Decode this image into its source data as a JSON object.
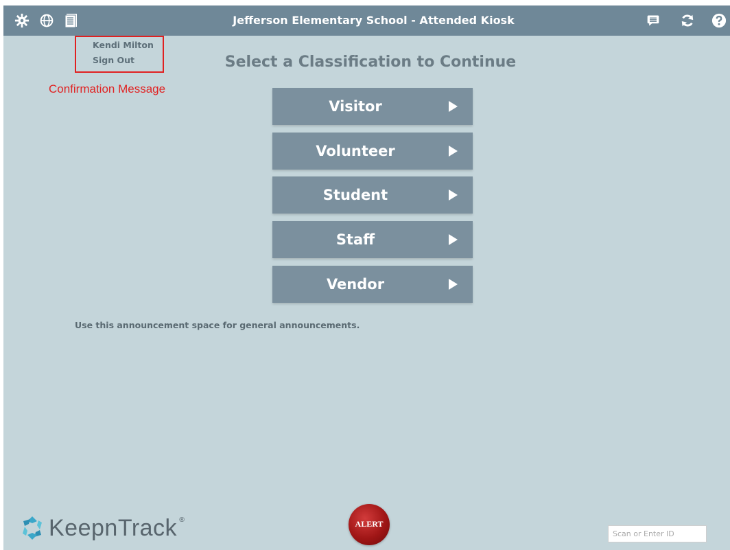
{
  "header": {
    "title": "Jefferson Elementary School - Attended Kiosk",
    "left_icons": [
      "settings-gear-icon",
      "globe-icon",
      "document-icon"
    ],
    "right_icons": [
      "message-icon",
      "refresh-icon",
      "help-icon"
    ]
  },
  "user": {
    "name": "Kendi Milton",
    "sign_out": "Sign Out"
  },
  "confirmation": {
    "text": "Confirmation Message"
  },
  "page_title": "Select a Classification to Continue",
  "classifications": [
    "Visitor",
    "Volunteer",
    "Student",
    "Staff",
    "Vendor"
  ],
  "announcement": "Use this announcement space for general announcements.",
  "footer": {
    "brand": "KeepnTrack",
    "registered": "®",
    "alert_label": "ALERT",
    "scan_placeholder": "Scan or Enter ID"
  },
  "colors": {
    "background": "#c4d5da",
    "header": "#6f8898",
    "button": "#7b909e",
    "annotation": "#e02020",
    "alert": "#a01616"
  }
}
